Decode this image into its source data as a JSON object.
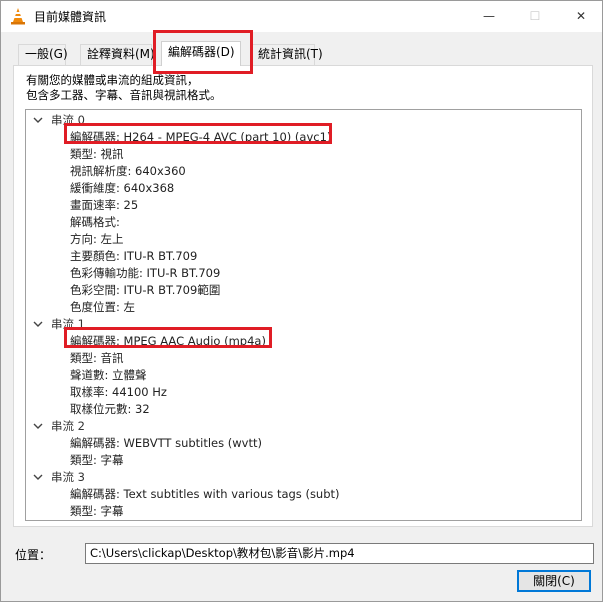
{
  "window": {
    "title": "目前媒體資訊",
    "icon": "vlc-cone-icon",
    "controls": {
      "minimize": "—",
      "maximize": "☐",
      "close": "✕"
    }
  },
  "tabs": [
    {
      "label": "一般(G)"
    },
    {
      "label": "詮釋資料(M)"
    },
    {
      "label": "編解碼器(D)",
      "selected": true
    },
    {
      "label": "統計資訊(T)"
    }
  ],
  "description": {
    "line1": "有關您的媒體或串流的組成資訊，",
    "line2": "包含多工器、字幕、音訊與視訊格式。"
  },
  "streams": [
    {
      "label": "串流 0",
      "props": [
        "編解碼器: H264 - MPEG-4 AVC (part 10) (avc1)",
        "類型: 視訊",
        "視訊解析度: 640x360",
        "緩衝維度: 640x368",
        "畫面速率: 25",
        "解碼格式:",
        "方向: 左上",
        "主要顏色: ITU-R BT.709",
        "色彩傳輸功能: ITU-R BT.709",
        "色彩空間: ITU-R BT.709範圍",
        "色度位置: 左"
      ]
    },
    {
      "label": "串流 1",
      "props": [
        "編解碼器: MPEG AAC Audio (mp4a)",
        "類型: 音訊",
        "聲道數: 立體聲",
        "取樣率: 44100 Hz",
        "取樣位元數: 32"
      ]
    },
    {
      "label": "串流 2",
      "props": [
        "編解碼器: WEBVTT subtitles (wvtt)",
        "類型: 字幕"
      ]
    },
    {
      "label": "串流 3",
      "props": [
        "編解碼器: Text subtitles with various tags (subt)",
        "類型: 字幕"
      ]
    }
  ],
  "location": {
    "label": "位置：",
    "value": "C:\\Users\\clickap\\Desktop\\教材包\\影音\\影片.mp4"
  },
  "close_button": "關閉(C)",
  "colors": {
    "highlight": "#e01d25",
    "focus": "#0078d7"
  }
}
